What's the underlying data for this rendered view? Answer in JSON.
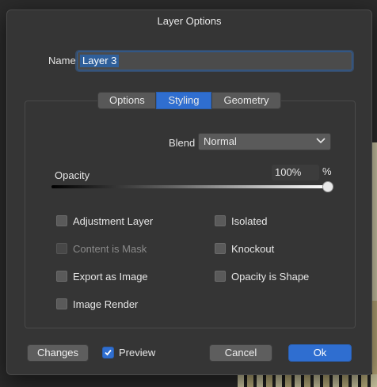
{
  "window": {
    "title": "Layer Options"
  },
  "name_field": {
    "label": "Name",
    "value": "Layer 3"
  },
  "tabs": [
    {
      "label": "Options",
      "active": false
    },
    {
      "label": "Styling",
      "active": true
    },
    {
      "label": "Geometry",
      "active": false
    }
  ],
  "blend": {
    "label": "Blend",
    "value": "Normal",
    "icon": "chevron-down-icon"
  },
  "opacity": {
    "label": "Opacity",
    "value": "100%",
    "unit": "%",
    "fraction": 1.0
  },
  "checkboxes": {
    "adjustment_layer": {
      "label": "Adjustment Layer",
      "checked": false,
      "enabled": true
    },
    "content_is_mask": {
      "label": "Content is Mask",
      "checked": false,
      "enabled": false
    },
    "export_as_image": {
      "label": "Export as Image",
      "checked": false,
      "enabled": true
    },
    "image_render": {
      "label": "Image Render",
      "checked": false,
      "enabled": true
    },
    "isolated": {
      "label": "Isolated",
      "checked": false,
      "enabled": true
    },
    "knockout": {
      "label": "Knockout",
      "checked": false,
      "enabled": true
    },
    "opacity_is_shape": {
      "label": "Opacity is Shape",
      "checked": false,
      "enabled": true
    }
  },
  "footer": {
    "changes_label": "Changes",
    "preview_label": "Preview",
    "preview_checked": true,
    "cancel_label": "Cancel",
    "ok_label": "Ok"
  },
  "colors": {
    "accent": "#2f6ed0",
    "dialog_bg": "#353535"
  }
}
